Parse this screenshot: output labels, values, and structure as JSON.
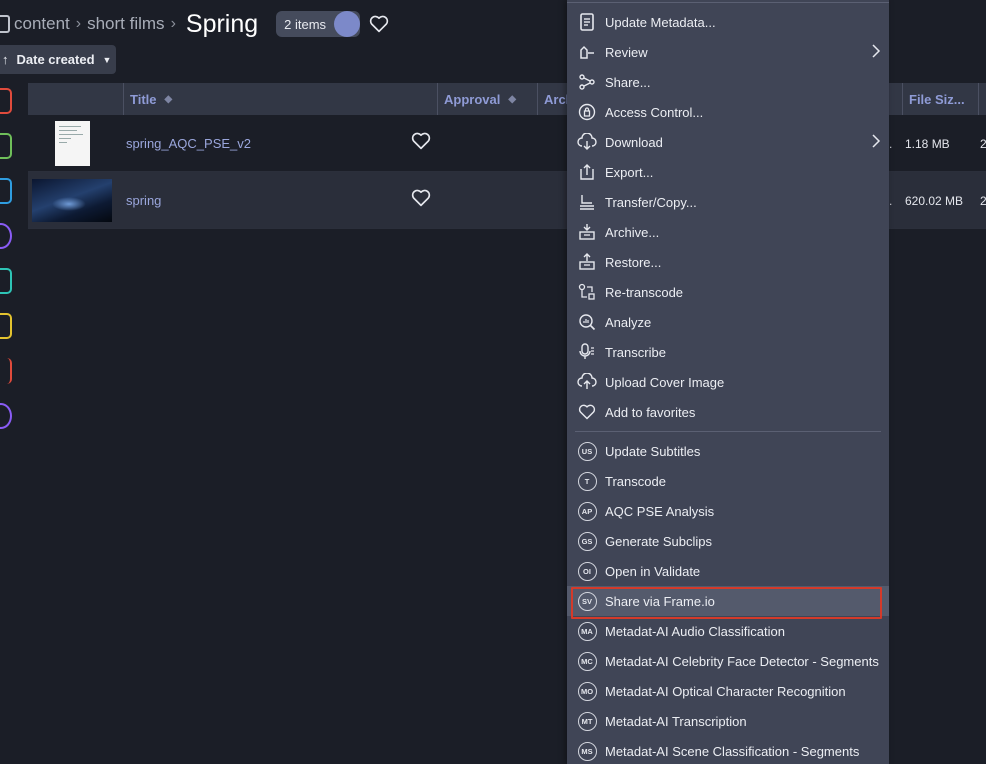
{
  "breadcrumb": {
    "items": [
      "content",
      "short films"
    ],
    "current": "Spring",
    "item_count": "2 items"
  },
  "toolbar": {
    "sort_label": "Date created"
  },
  "rail": {
    "icon_colors": [
      "#e04b3c",
      "#6fbf5a",
      "#2f9de0",
      "#8a5cf5",
      "#2ec4b6",
      "#e3c32f",
      "#e04b3c",
      "#8a5cf5"
    ]
  },
  "table": {
    "columns": {
      "title": "Title",
      "approval": "Approval",
      "archive": "Arch",
      "file_size": "File Siz..."
    },
    "rows": [
      {
        "title": "spring_AQC_PSE_v2",
        "dots": ".",
        "file_size": "1.18 MB",
        "extra": "2"
      },
      {
        "title": "spring",
        "dots": ".",
        "file_size": "620.02 MB",
        "extra": "2"
      }
    ]
  },
  "context_menu": {
    "items": [
      {
        "label": "Update Metadata...",
        "icon": "edit-document-icon"
      },
      {
        "label": "Review",
        "icon": "review-icon",
        "submenu": true
      },
      {
        "label": "Share...",
        "icon": "share-icon"
      },
      {
        "label": "Access Control...",
        "icon": "lock-icon"
      },
      {
        "label": "Download",
        "icon": "cloud-download-icon",
        "submenu": true
      },
      {
        "label": "Export...",
        "icon": "export-icon"
      },
      {
        "label": "Transfer/Copy...",
        "icon": "transfer-icon"
      },
      {
        "label": "Archive...",
        "icon": "archive-icon"
      },
      {
        "label": "Restore...",
        "icon": "restore-icon"
      },
      {
        "label": "Re-transcode",
        "icon": "retranscode-icon"
      },
      {
        "label": "Analyze",
        "icon": "analyze-icon"
      },
      {
        "label": "Transcribe",
        "icon": "transcribe-icon"
      },
      {
        "label": "Upload Cover Image",
        "icon": "cloud-upload-icon"
      },
      {
        "label": "Add to favorites",
        "icon": "heart-icon"
      }
    ],
    "workflows": [
      {
        "badge": "US",
        "label": "Update Subtitles"
      },
      {
        "badge": "T",
        "label": "Transcode"
      },
      {
        "badge": "AP",
        "label": "AQC PSE Analysis"
      },
      {
        "badge": "GS",
        "label": "Generate Subclips"
      },
      {
        "badge": "OI",
        "label": "Open in Validate"
      },
      {
        "badge": "SV",
        "label": "Share via Frame.io"
      },
      {
        "badge": "MA",
        "label": "Metadat-AI Audio Classification"
      },
      {
        "badge": "MC",
        "label": "Metadat-AI Celebrity Face Detector - Segments"
      },
      {
        "badge": "MO",
        "label": "Metadat-AI Optical Character Recognition"
      },
      {
        "badge": "MT",
        "label": "Metadat-AI Transcription"
      },
      {
        "badge": "MS",
        "label": "Metadat-AI Scene Classification - Segments"
      }
    ],
    "highlighted": "Share via Frame.io"
  }
}
